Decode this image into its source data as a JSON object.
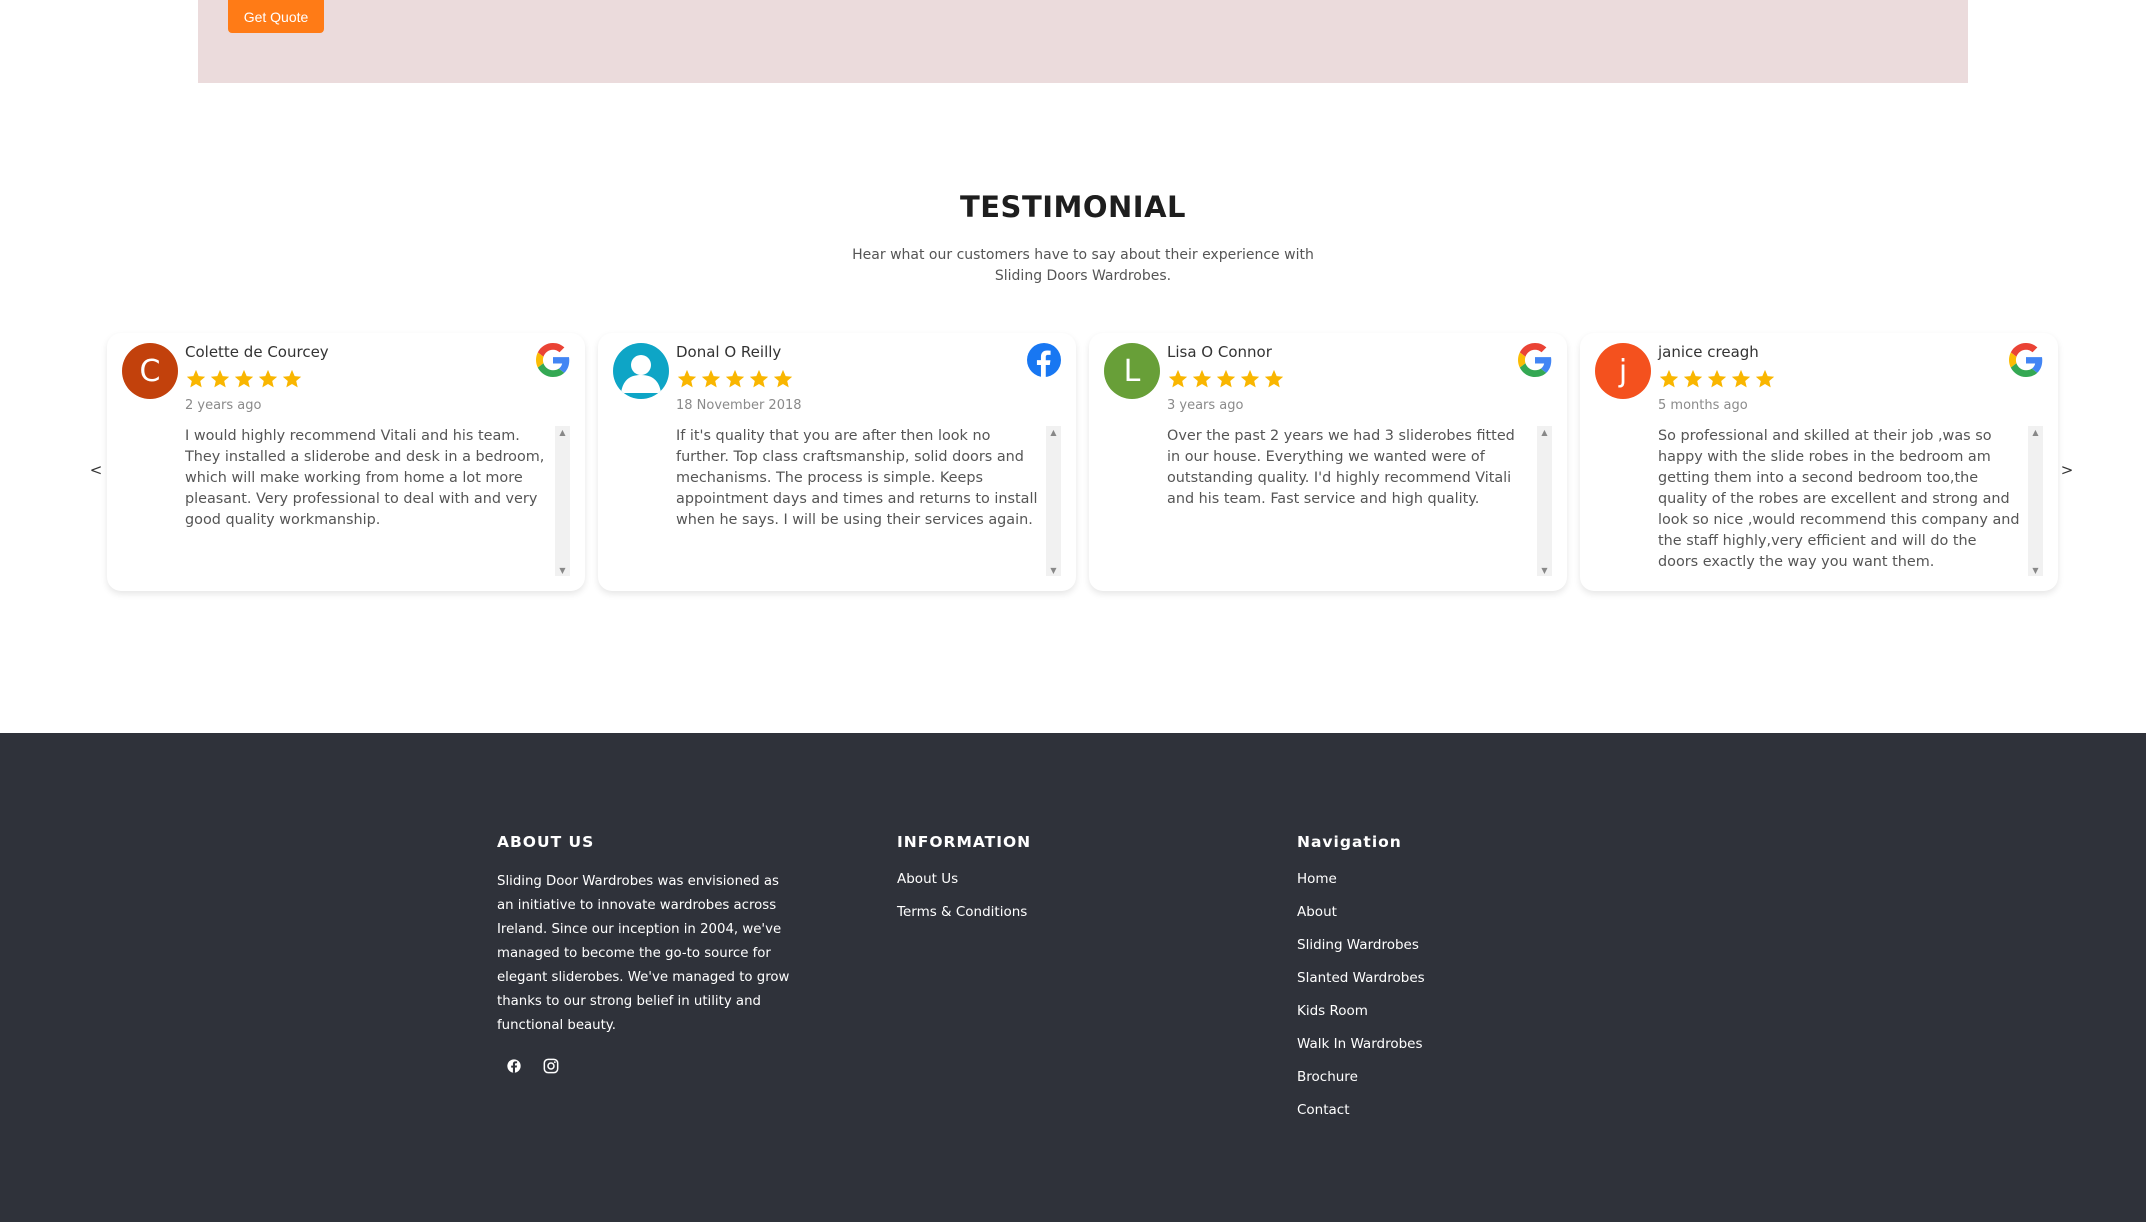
{
  "cta": {
    "button_label": "Get Quote",
    "band_color": "#ebdbdc",
    "button_color": "#ff7b16"
  },
  "testimonial": {
    "title": "TESTIMONIAL",
    "subtitle": "Hear what our customers have to say about their experience with Sliding Doors Wardrobes.",
    "prev_arrow": "<",
    "next_arrow": ">",
    "reviews": [
      {
        "name": "Colette de Courcey",
        "avatar_letter": "C",
        "avatar_color": "#c2410c",
        "rating": 5,
        "date": "2 years ago",
        "source": "google-icon",
        "text": "I would highly recommend Vitali and his team. They installed a sliderobe and desk in a bedroom, which will make working from home a lot more pleasant. Very professional to deal with and very good quality workmanship."
      },
      {
        "name": "Donal O Reilly",
        "avatar_letter": "",
        "avatar_color": "#0ea5c6",
        "rating": 5,
        "date": "18 November 2018",
        "source": "facebook-icon",
        "text": "If it's quality that you are after then look no further. Top class craftsmanship, solid doors and mechanisms. The process is simple. Keeps appointment days and times and returns to install when he says. I will be using their services again."
      },
      {
        "name": "Lisa O Connor",
        "avatar_letter": "L",
        "avatar_color": "#689f38",
        "rating": 5,
        "date": "3 years ago",
        "source": "google-icon",
        "text": "Over the past 2 years we had 3 sliderobes fitted in our house. Everything we wanted were of outstanding quality. I'd highly recommend Vitali and his team. Fast service and high quality."
      },
      {
        "name": "janice creagh",
        "avatar_letter": "j",
        "avatar_color": "#f4511e",
        "rating": 5,
        "date": "5 months ago",
        "source": "google-icon",
        "text": "So professional and skilled at their job ,was so happy with the slide robes in the bedroom am getting them into a second bedroom too,the quality of the robes are excellent and strong and look so nice ,would recommend this company and the staff highly,very efficient and will do the doors exactly the way you want them."
      }
    ]
  },
  "footer": {
    "about": {
      "heading": "ABOUT US",
      "text": "Sliding Door Wardrobes was envisioned as an initiative to innovate wardrobes across Ireland. Since our inception in 2004, we've managed to become the go-to source for elegant sliderobes. We've managed to grow thanks to our strong belief in utility and functional beauty.",
      "social": [
        "facebook-icon",
        "instagram-icon"
      ]
    },
    "information": {
      "heading": "INFORMATION",
      "links": [
        "About Us",
        "Terms & Conditions"
      ]
    },
    "navigation": {
      "heading": "Navigation",
      "links": [
        "Home",
        "About",
        "Sliding Wardrobes",
        "Slanted Wardrobes",
        "Kids Room",
        "Walk In Wardrobes",
        "Brochure",
        "Contact"
      ]
    },
    "background": "#2f323a"
  }
}
